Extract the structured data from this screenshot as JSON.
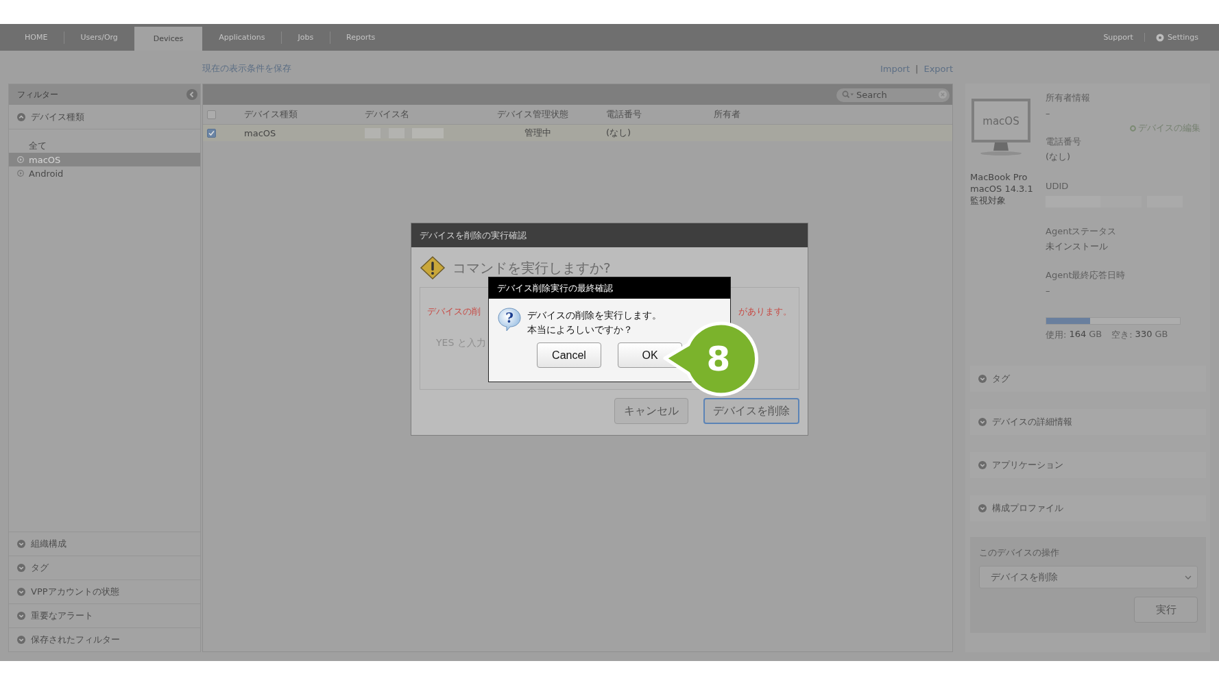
{
  "nav": {
    "tabs": [
      {
        "label": "HOME",
        "selected": false
      },
      {
        "label": "Users/Org",
        "selected": false
      },
      {
        "label": "Devices",
        "selected": true
      },
      {
        "label": "Applications",
        "selected": false
      },
      {
        "label": "Jobs",
        "selected": false
      },
      {
        "label": "Reports",
        "selected": false
      }
    ],
    "right_links": [
      {
        "label": "Support",
        "kind": "plain"
      },
      {
        "label": "Settings",
        "kind": "gear"
      }
    ]
  },
  "toolbar_links": {
    "save_view": "現在の表示条件を保存",
    "import": "Import",
    "separator": "|",
    "export": "Export"
  },
  "sidebar": {
    "title": "フィルター",
    "top_section": {
      "label": "デバイス種類",
      "expanded": true,
      "items": [
        {
          "label": "全て",
          "selected": false,
          "kind": "all"
        },
        {
          "label": "macOS",
          "selected": true,
          "kind": "os"
        },
        {
          "label": "Android",
          "selected": false,
          "kind": "os"
        }
      ]
    },
    "bottom_sections": [
      {
        "label": "組織構成",
        "expanded": false
      },
      {
        "label": "タグ",
        "expanded": false
      },
      {
        "label": "VPPアカウントの状態",
        "expanded": false
      },
      {
        "label": "重要なアラート",
        "expanded": false
      },
      {
        "label": "保存されたフィルター",
        "expanded": false
      }
    ]
  },
  "table": {
    "search": {
      "placeholder": "Search"
    },
    "header_checked": false,
    "columns": [
      "デバイス種類",
      "デバイス名",
      "デバイス管理状態",
      "電話番号",
      "所有者"
    ],
    "rows": [
      {
        "checked": true,
        "type": "macOS",
        "status": "管理中",
        "phone": "(なし)"
      }
    ]
  },
  "device": {
    "screen_label": "macOS",
    "lines": [
      "MacBook Pro",
      "macOS 14.3.1",
      "監視対象"
    ],
    "owner_label": "所有者情報",
    "owner_value": "–",
    "edit_link": "デバイスの編集",
    "phone_label": "電話番号",
    "phone_value": "(なし)",
    "udid_label": "UDID",
    "agent_status_label": "Agentステータス",
    "agent_status_value": "未インストール",
    "agent_last_label": "Agent最終応答日時",
    "agent_last_value": "–",
    "storage": {
      "level": 0.33,
      "used_label": "使用:",
      "used": "164",
      "used_unit": "GB",
      "free_label": "空き:",
      "free": "330",
      "free_unit": "GB"
    },
    "sections": [
      {
        "label": "タグ",
        "expanded": false
      },
      {
        "label": "デバイスの詳細情報",
        "expanded": false
      },
      {
        "label": "アプリケーション",
        "expanded": false
      },
      {
        "label": "構成プロファイル",
        "expanded": false
      }
    ],
    "operations": {
      "title": "このデバイスの操作",
      "select_value": "デバイスを削除",
      "run_button": "実行"
    }
  },
  "confirm_dialog": {
    "title": "デバイスを削除の実行確認",
    "heading": "コマンドを実行しますか?",
    "warning_left": "デバイスの削",
    "warning_right": "があります。",
    "input_hint": "YES と入力",
    "buttons": [
      {
        "label": "キャンセル",
        "kind": "secondary"
      },
      {
        "label": "デバイスを削除",
        "kind": "primary"
      }
    ]
  },
  "final_dialog": {
    "title": "デバイス削除実行の最終確認",
    "icon_glyph": "?",
    "message_lines": [
      "デバイスの削除を実行します。",
      "本当によろしいですか？"
    ],
    "buttons": [
      {
        "label": "Cancel"
      },
      {
        "label": "OK"
      }
    ]
  },
  "callout": {
    "label": "8"
  }
}
